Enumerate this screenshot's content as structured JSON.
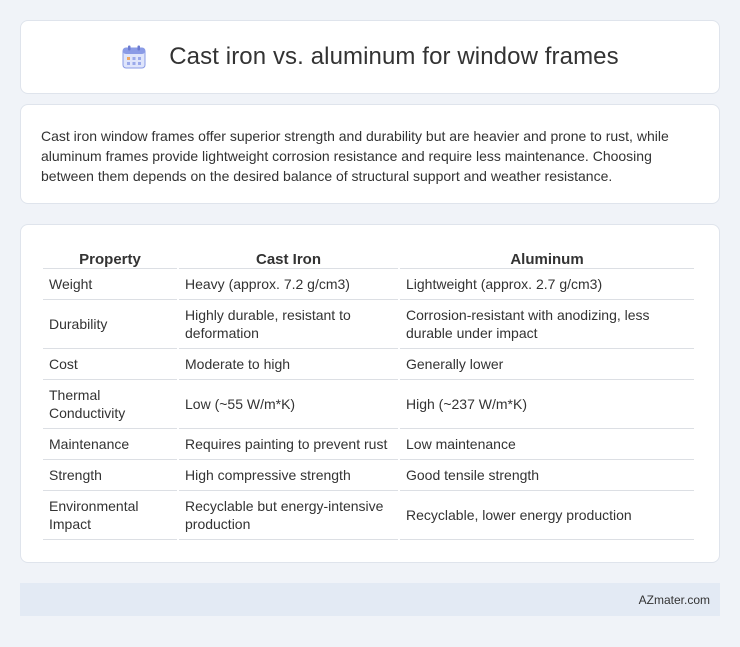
{
  "header": {
    "title": "Cast iron vs. aluminum for window frames",
    "icon": "calendar-icon"
  },
  "summary": {
    "text": "Cast iron window frames offer superior strength and durability but are heavier and prone to rust, while aluminum frames provide lightweight corrosion resistance and require less maintenance. Choosing between them depends on the desired balance of structural support and weather resistance."
  },
  "table": {
    "headers": [
      "Property",
      "Cast Iron",
      "Aluminum"
    ],
    "rows": [
      [
        "Weight",
        "Heavy (approx. 7.2 g/cm3)",
        "Lightweight (approx. 2.7 g/cm3)"
      ],
      [
        "Durability",
        "Highly durable, resistant to deformation",
        "Corrosion-resistant with anodizing, less durable under impact"
      ],
      [
        "Cost",
        "Moderate to high",
        "Generally lower"
      ],
      [
        "Thermal Conductivity",
        "Low (~55 W/m*K)",
        "High (~237 W/m*K)"
      ],
      [
        "Maintenance",
        "Requires painting to prevent rust",
        "Low maintenance"
      ],
      [
        "Strength",
        "High compressive strength",
        "Good tensile strength"
      ],
      [
        "Environmental Impact",
        "Recyclable but energy-intensive production",
        "Recyclable, lower energy production"
      ]
    ]
  },
  "footer": {
    "brand": "AZmater.com"
  },
  "colors": {
    "page_background": "#f0f3f8",
    "card_background": "#ffffff",
    "footer_background": "#e3eaf4",
    "icon_accent": "#7b8fe0"
  }
}
